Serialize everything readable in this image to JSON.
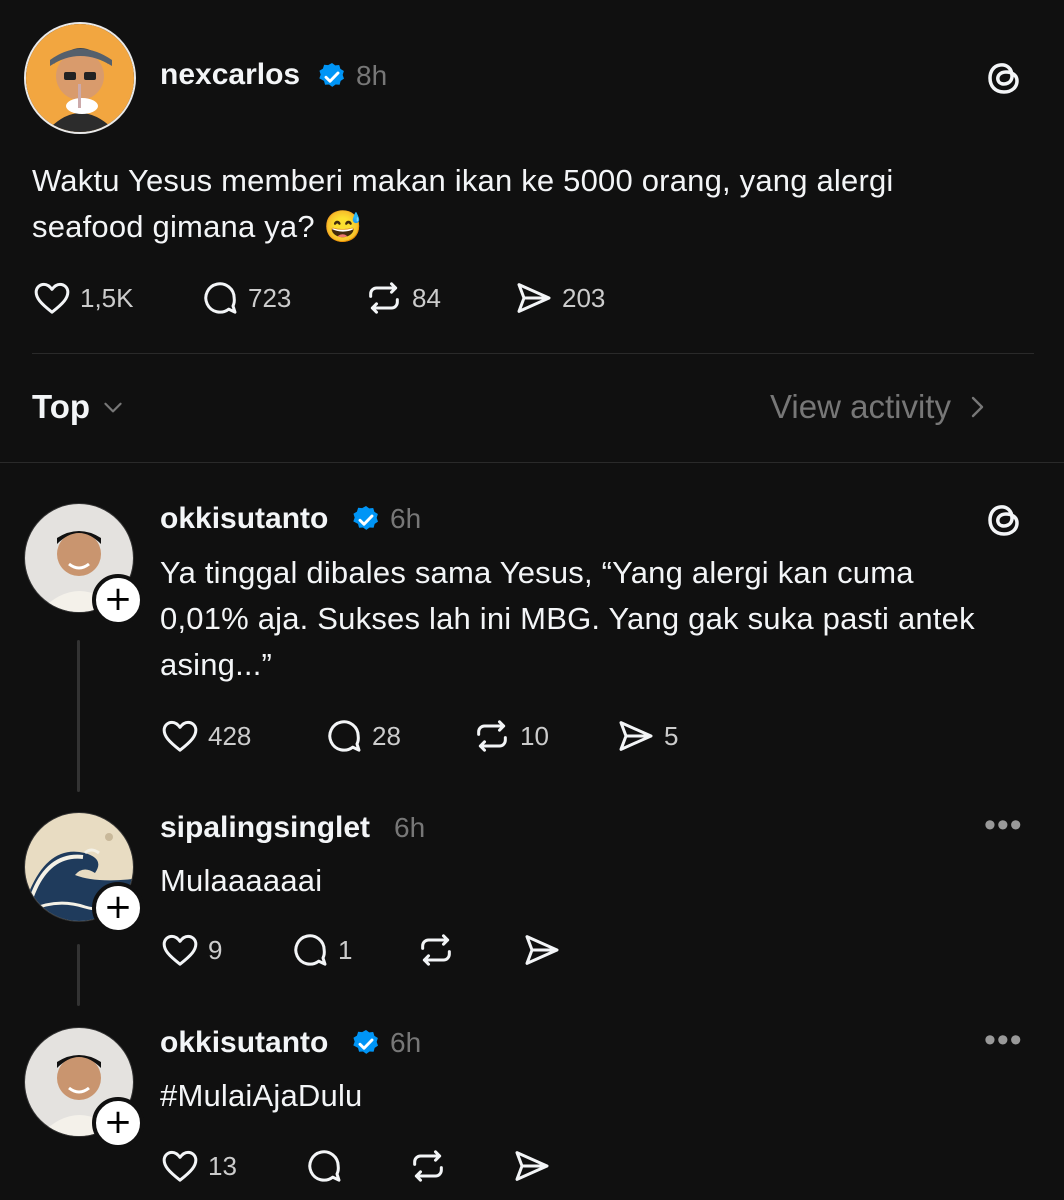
{
  "post": {
    "username": "nexcarlos",
    "time": "8h",
    "text_line1": "Waktu Yesus memberi makan ikan ke 5000 orang, yang alergi",
    "text_line2": "seafood gimana ya?",
    "emoji": "😅",
    "likes": "1,5K",
    "replies": "723",
    "reposts": "84",
    "shares": "203"
  },
  "sort": {
    "label": "Top",
    "view_activity": "View activity"
  },
  "comments": [
    {
      "username": "okkisutanto",
      "time": "6h",
      "text": [
        "Ya tinggal dibales sama Yesus, “Yang alergi kan cuma",
        "0,01% aja. Sukses lah ini MBG. Yang gak suka pasti antek",
        "asing...”"
      ],
      "likes": "428",
      "replies": "28",
      "reposts": "10",
      "shares": "5"
    },
    {
      "username": "sipalingsinglet",
      "time": "6h",
      "text": [
        "Mulaaaaaai"
      ],
      "likes": "9",
      "replies": "1",
      "reposts": "",
      "shares": ""
    },
    {
      "username": "okkisutanto",
      "time": "6h",
      "text": [
        "#MulaiAjaDulu"
      ],
      "likes": "13",
      "replies": "",
      "reposts": "",
      "shares": ""
    }
  ],
  "icons": {
    "verified_color": "#0095f6",
    "accent": "#f3f5f7"
  }
}
